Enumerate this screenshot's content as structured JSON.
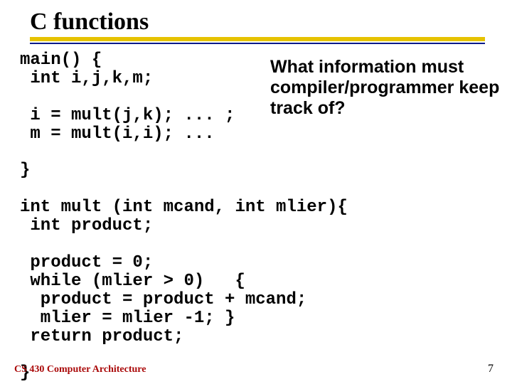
{
  "title": "C functions",
  "code": "main() {\n int i,j,k,m;\n\n i = mult(j,k); ... ;\n m = mult(i,i); ...\n\n}\n\nint mult (int mcand, int mlier){\n int product;\n\n product = 0;\n while (mlier > 0)   {\n  product = product + mcand;\n  mlier = mlier -1; }\n return product;\n\n}",
  "callout": "What information must compiler/programmer keep track of?",
  "footer": {
    "left": "CS 430 Computer Architecture",
    "right": "7"
  }
}
